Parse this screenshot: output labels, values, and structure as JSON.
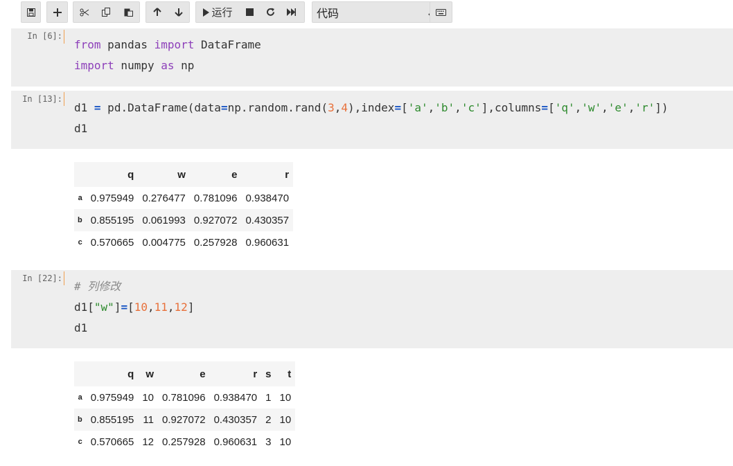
{
  "toolbar": {
    "run_label": "运行",
    "cell_type": "代码"
  },
  "cells": [
    {
      "prompt": "In [6]:",
      "lines": [
        [
          {
            "t": "from",
            "c": "kw"
          },
          {
            "t": " pandas ",
            "c": ""
          },
          {
            "t": "import",
            "c": "kw"
          },
          {
            "t": " DataFrame",
            "c": ""
          }
        ],
        [
          {
            "t": "import",
            "c": "kw"
          },
          {
            "t": " numpy ",
            "c": ""
          },
          {
            "t": "as",
            "c": "kw"
          },
          {
            "t": " np",
            "c": ""
          }
        ]
      ]
    },
    {
      "prompt": "In [13]:",
      "lines": [
        [
          {
            "t": "d1 ",
            "c": ""
          },
          {
            "t": "=",
            "c": "op"
          },
          {
            "t": " pd.DataFrame(data",
            "c": ""
          },
          {
            "t": "=",
            "c": "op"
          },
          {
            "t": "np.random.rand(",
            "c": ""
          },
          {
            "t": "3",
            "c": "num"
          },
          {
            "t": ",",
            "c": ""
          },
          {
            "t": "4",
            "c": "num"
          },
          {
            "t": "),index",
            "c": ""
          },
          {
            "t": "=",
            "c": "op"
          },
          {
            "t": "[",
            "c": ""
          },
          {
            "t": "'a'",
            "c": "str"
          },
          {
            "t": ",",
            "c": ""
          },
          {
            "t": "'b'",
            "c": "str"
          },
          {
            "t": ",",
            "c": ""
          },
          {
            "t": "'c'",
            "c": "str"
          },
          {
            "t": "],columns",
            "c": ""
          },
          {
            "t": "=",
            "c": "op"
          },
          {
            "t": "[",
            "c": ""
          },
          {
            "t": "'q'",
            "c": "str"
          },
          {
            "t": ",",
            "c": ""
          },
          {
            "t": "'w'",
            "c": "str"
          },
          {
            "t": ",",
            "c": ""
          },
          {
            "t": "'e'",
            "c": "str"
          },
          {
            "t": ",",
            "c": ""
          },
          {
            "t": "'r'",
            "c": "str"
          },
          {
            "t": "])",
            "c": ""
          }
        ],
        [
          {
            "t": "d1",
            "c": ""
          }
        ]
      ],
      "output": {
        "columns": [
          "",
          "q",
          "w",
          "e",
          "r"
        ],
        "rows": [
          [
            "a",
            "0.975949",
            "0.276477",
            "0.781096",
            "0.938470"
          ],
          [
            "b",
            "0.855195",
            "0.061993",
            "0.927072",
            "0.430357"
          ],
          [
            "c",
            "0.570665",
            "0.004775",
            "0.257928",
            "0.960631"
          ]
        ]
      }
    },
    {
      "prompt": "In [22]:",
      "lines": [
        [
          {
            "t": "# 列修改",
            "c": "cmt"
          }
        ],
        [
          {
            "t": "d1[",
            "c": ""
          },
          {
            "t": "\"w\"",
            "c": "str"
          },
          {
            "t": "]",
            "c": ""
          },
          {
            "t": "=",
            "c": "op"
          },
          {
            "t": "[",
            "c": ""
          },
          {
            "t": "10",
            "c": "num"
          },
          {
            "t": ",",
            "c": ""
          },
          {
            "t": "11",
            "c": "num"
          },
          {
            "t": ",",
            "c": ""
          },
          {
            "t": "12",
            "c": "num"
          },
          {
            "t": "]",
            "c": ""
          }
        ],
        [
          {
            "t": "d1",
            "c": ""
          }
        ]
      ],
      "output": {
        "columns": [
          "",
          "q",
          "w",
          "e",
          "r",
          "s",
          "t"
        ],
        "rows": [
          [
            "a",
            "0.975949",
            "10",
            "0.781096",
            "0.938470",
            "1",
            "10"
          ],
          [
            "b",
            "0.855195",
            "11",
            "0.927072",
            "0.430357",
            "2",
            "10"
          ],
          [
            "c",
            "0.570665",
            "12",
            "0.257928",
            "0.960631",
            "3",
            "10"
          ]
        ]
      }
    }
  ]
}
